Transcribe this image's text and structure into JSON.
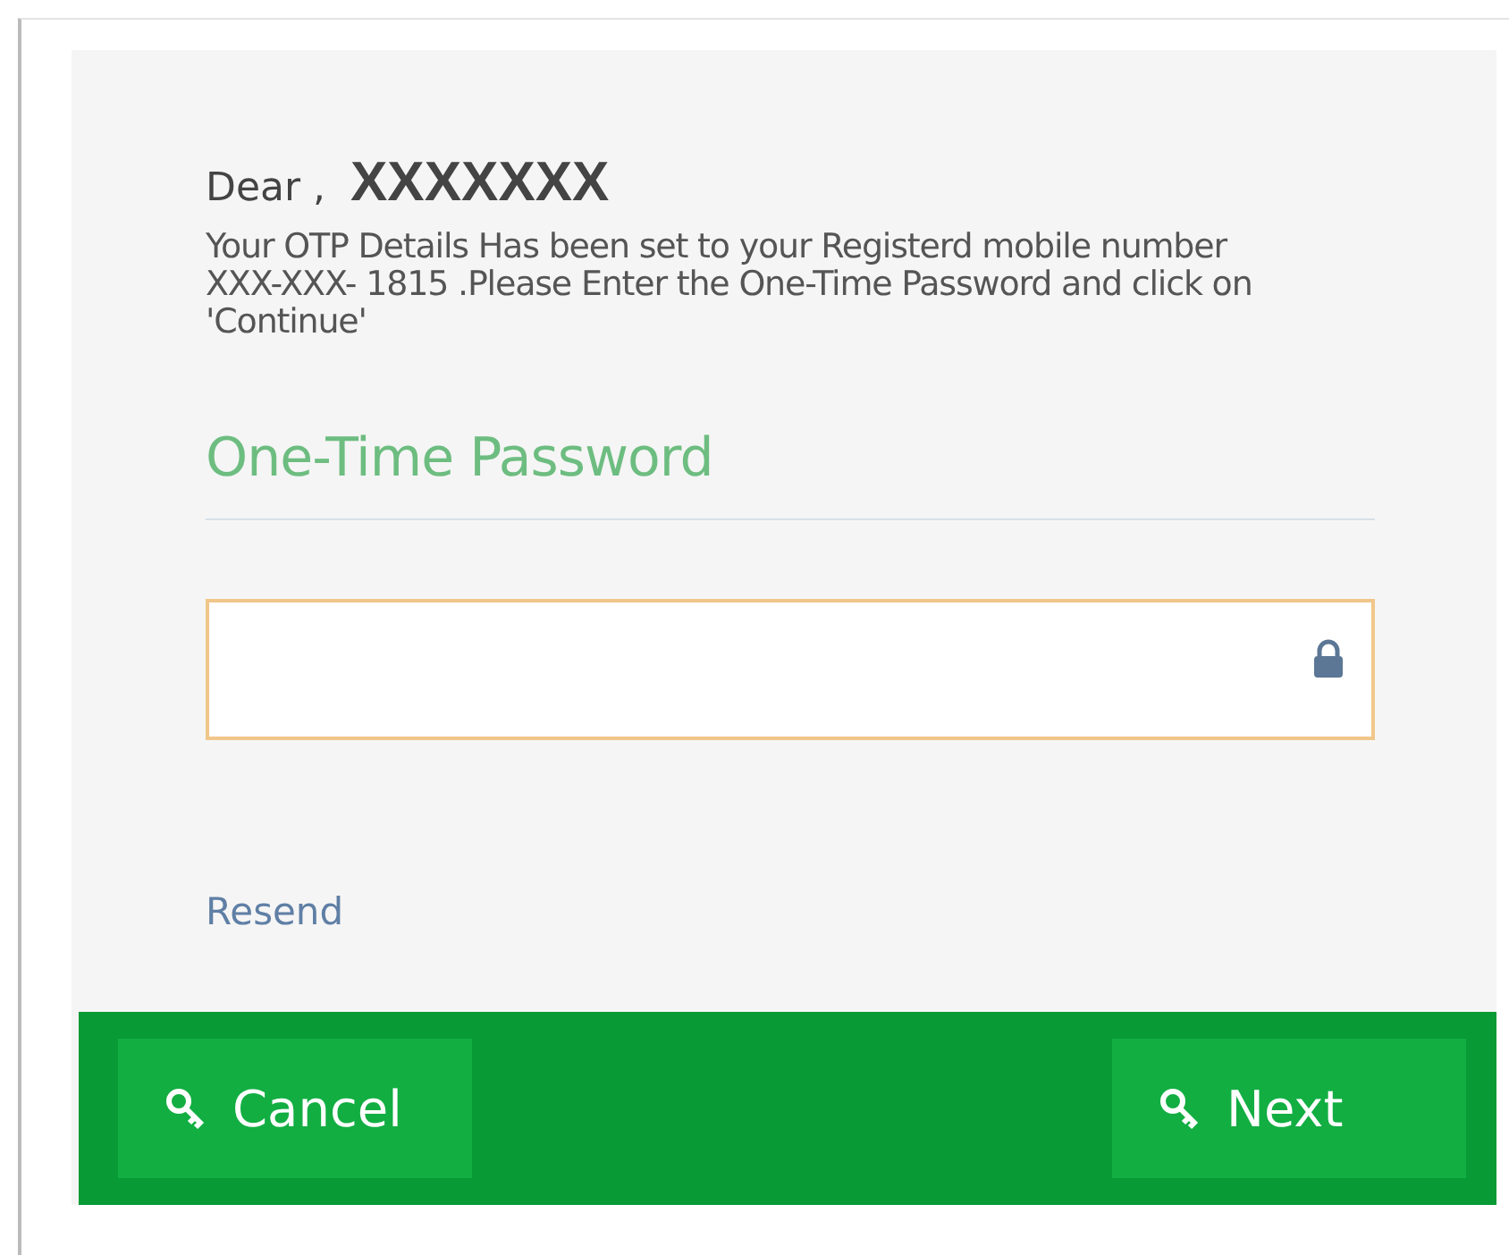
{
  "greeting": {
    "label": "Dear ,",
    "name": "XXXXXXX"
  },
  "message": "Your OTP Details Has been set to your Registerd mobile number XXX-XXX- 1815 .Please Enter the One-Time Password and click on 'Continue'",
  "section_title": "One-Time Password",
  "resend_link": "Resend",
  "buttons": [
    {
      "label": "Cancel"
    },
    {
      "label": "Next"
    }
  ]
}
